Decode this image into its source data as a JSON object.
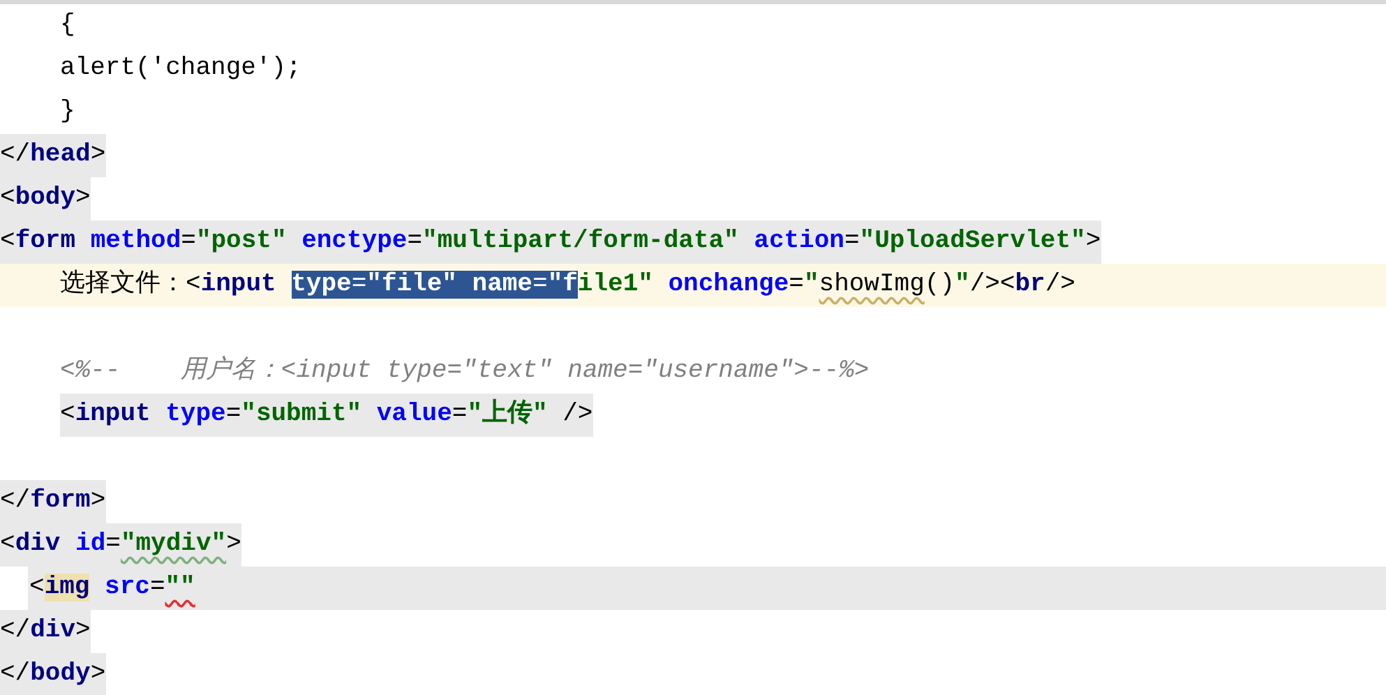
{
  "editor": {
    "lines": [
      {
        "kind": "inner",
        "shaded": false,
        "tokens": [
          {
            "kind": "plain",
            "text": "{"
          }
        ]
      },
      {
        "kind": "inner",
        "shaded": false,
        "tokens": [
          {
            "kind": "plain",
            "text": "alert('change');"
          }
        ]
      },
      {
        "kind": "inner",
        "shaded": false,
        "tokens": [
          {
            "kind": "plain",
            "text": "}"
          }
        ]
      },
      {
        "kind": "outer",
        "shaded": true,
        "tokens": [
          {
            "kind": "punct",
            "text": "</"
          },
          {
            "kind": "tag",
            "text": "head"
          },
          {
            "kind": "punct",
            "text": ">"
          }
        ]
      },
      {
        "kind": "outer",
        "shaded": true,
        "tokens": [
          {
            "kind": "punct",
            "text": "<"
          },
          {
            "kind": "tag",
            "text": "body"
          },
          {
            "kind": "punct",
            "text": ">"
          }
        ]
      },
      {
        "kind": "outer",
        "shaded": true,
        "tokens": [
          {
            "kind": "punct",
            "text": "<"
          },
          {
            "kind": "tag",
            "text": "form "
          },
          {
            "kind": "attr",
            "text": "method"
          },
          {
            "kind": "punct",
            "text": "="
          },
          {
            "kind": "str",
            "text": "\"post\" "
          },
          {
            "kind": "attr",
            "text": "enctype"
          },
          {
            "kind": "punct",
            "text": "="
          },
          {
            "kind": "str",
            "text": "\"multipart/form-data\" "
          },
          {
            "kind": "attr",
            "text": "action"
          },
          {
            "kind": "punct",
            "text": "="
          },
          {
            "kind": "str",
            "text": "\"UploadServlet\""
          },
          {
            "kind": "punct",
            "text": ">"
          }
        ]
      },
      {
        "kind": "inner",
        "shaded": false,
        "current": true,
        "tokens": [
          {
            "kind": "plain",
            "text": "选择文件："
          },
          {
            "kind": "punct",
            "text": "<"
          },
          {
            "kind": "tag",
            "text": "input "
          },
          {
            "kind": "attr",
            "text": "type",
            "selected": true
          },
          {
            "kind": "punct",
            "text": "=",
            "selected": true
          },
          {
            "kind": "str",
            "text": "\"file\" ",
            "selected": true
          },
          {
            "kind": "attr",
            "text": "name",
            "selected": true
          },
          {
            "kind": "punct",
            "text": "=",
            "selected": true
          },
          {
            "kind": "str",
            "text": "\"f",
            "selected": true
          },
          {
            "kind": "str",
            "text": "ile1\" "
          },
          {
            "kind": "attr",
            "text": "onchange"
          },
          {
            "kind": "punct",
            "text": "="
          },
          {
            "kind": "str",
            "text": "\""
          },
          {
            "kind": "plain",
            "text": "showImg",
            "color": "#c9b06a"
          },
          {
            "kind": "plain",
            "text": "()"
          },
          {
            "kind": "str",
            "text": "\""
          },
          {
            "kind": "punct",
            "text": "/><"
          },
          {
            "kind": "tag",
            "text": "br"
          },
          {
            "kind": "punct",
            "text": "/>"
          }
        ]
      },
      {
        "kind": "blank"
      },
      {
        "kind": "inner",
        "shaded": false,
        "tokens": [
          {
            "kind": "comment",
            "text": "<%--    用户名：<input type=\"text\" name=\"username\">--%>"
          }
        ]
      },
      {
        "kind": "inner",
        "shaded": true,
        "tokens": [
          {
            "kind": "punct",
            "text": "<"
          },
          {
            "kind": "tag",
            "text": "input "
          },
          {
            "kind": "attr",
            "text": "type"
          },
          {
            "kind": "punct",
            "text": "="
          },
          {
            "kind": "str",
            "text": "\"submit\" "
          },
          {
            "kind": "attr",
            "text": "value"
          },
          {
            "kind": "punct",
            "text": "="
          },
          {
            "kind": "str",
            "text": "\"上传\" "
          },
          {
            "kind": "punct",
            "text": "/>"
          }
        ]
      },
      {
        "kind": "blank"
      },
      {
        "kind": "outer",
        "shaded": true,
        "tokens": [
          {
            "kind": "punct",
            "text": "</"
          },
          {
            "kind": "tag",
            "text": "form"
          },
          {
            "kind": "punct",
            "text": ">"
          }
        ]
      },
      {
        "kind": "outer",
        "shaded": true,
        "tokens": [
          {
            "kind": "punct",
            "text": "<"
          },
          {
            "kind": "tag",
            "text": "div "
          },
          {
            "kind": "attr",
            "text": "id"
          },
          {
            "kind": "punct",
            "text": "="
          },
          {
            "kind": "str",
            "text": "\"mydiv\"",
            "color": "#7fb07f"
          },
          {
            "kind": "punct",
            "text": ">"
          }
        ]
      },
      {
        "kind": "child",
        "shaded": true,
        "full_width": true,
        "tokens": [
          {
            "kind": "punct",
            "text": "<"
          },
          {
            "kind": "tag",
            "text": "img",
            "match": true
          },
          {
            "kind": "attr",
            "text": " src"
          },
          {
            "kind": "punct",
            "text": "="
          },
          {
            "kind": "str",
            "text": "\"\"",
            "color": "#e03030"
          }
        ]
      },
      {
        "kind": "outer",
        "shaded": true,
        "tokens": [
          {
            "kind": "punct",
            "text": "</"
          },
          {
            "kind": "tag",
            "text": "div"
          },
          {
            "kind": "punct",
            "text": ">"
          }
        ]
      },
      {
        "kind": "outer",
        "shaded": true,
        "tokens": [
          {
            "kind": "punct",
            "text": "</"
          },
          {
            "kind": "tag",
            "text": "body"
          },
          {
            "kind": "punct",
            "text": ">"
          }
        ]
      }
    ]
  }
}
